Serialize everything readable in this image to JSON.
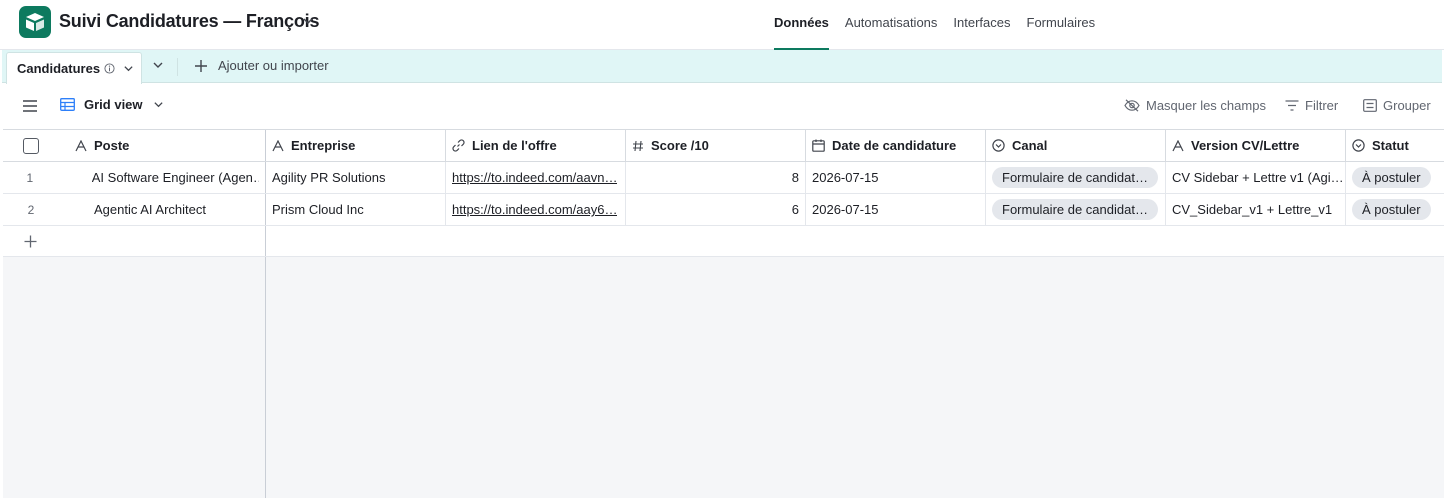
{
  "app": {
    "base_title": "Suivi Candidatures — François",
    "nav": [
      "Données",
      "Automatisations",
      "Interfaces",
      "Formulaires"
    ],
    "nav_active": "Données",
    "accent_color": "#0d7a5f"
  },
  "tabs": {
    "active_table": "Candidatures",
    "add_import_label": "Ajouter ou importer"
  },
  "viewbar": {
    "view_name": "Grid view",
    "hide_fields": "Masquer les champs",
    "filter": "Filtrer",
    "group": "Grouper"
  },
  "grid": {
    "columns": [
      {
        "label": "Poste",
        "icon": "text-icon"
      },
      {
        "label": "Entreprise",
        "icon": "text-icon"
      },
      {
        "label": "Lien de l'offre",
        "icon": "link-icon"
      },
      {
        "label": "Score /10",
        "icon": "number-icon"
      },
      {
        "label": "Date de candidature",
        "icon": "calendar-icon"
      },
      {
        "label": "Canal",
        "icon": "single-select-icon"
      },
      {
        "label": "Version CV/Lettre",
        "icon": "text-icon"
      },
      {
        "label": "Statut",
        "icon": "single-select-icon"
      }
    ],
    "rows": [
      {
        "num": "1",
        "poste": "AI Software Engineer (Agen…",
        "entreprise": "Agility PR Solutions",
        "lien": "https://to.indeed.com/aavn…",
        "score": "8",
        "date": "2026-07-15",
        "canal": "Formulaire de candidat…",
        "version": "CV Sidebar + Lettre v1 (Agi…",
        "statut": "À postuler"
      },
      {
        "num": "2",
        "poste": "Agentic AI Architect",
        "entreprise": "Prism Cloud Inc",
        "lien": "https://to.indeed.com/aay6…",
        "score": "6",
        "date": "2026-07-15",
        "canal": "Formulaire de candidat…",
        "version": "CV_Sidebar_v1 + Lettre_v1",
        "statut": "À postuler"
      }
    ]
  }
}
